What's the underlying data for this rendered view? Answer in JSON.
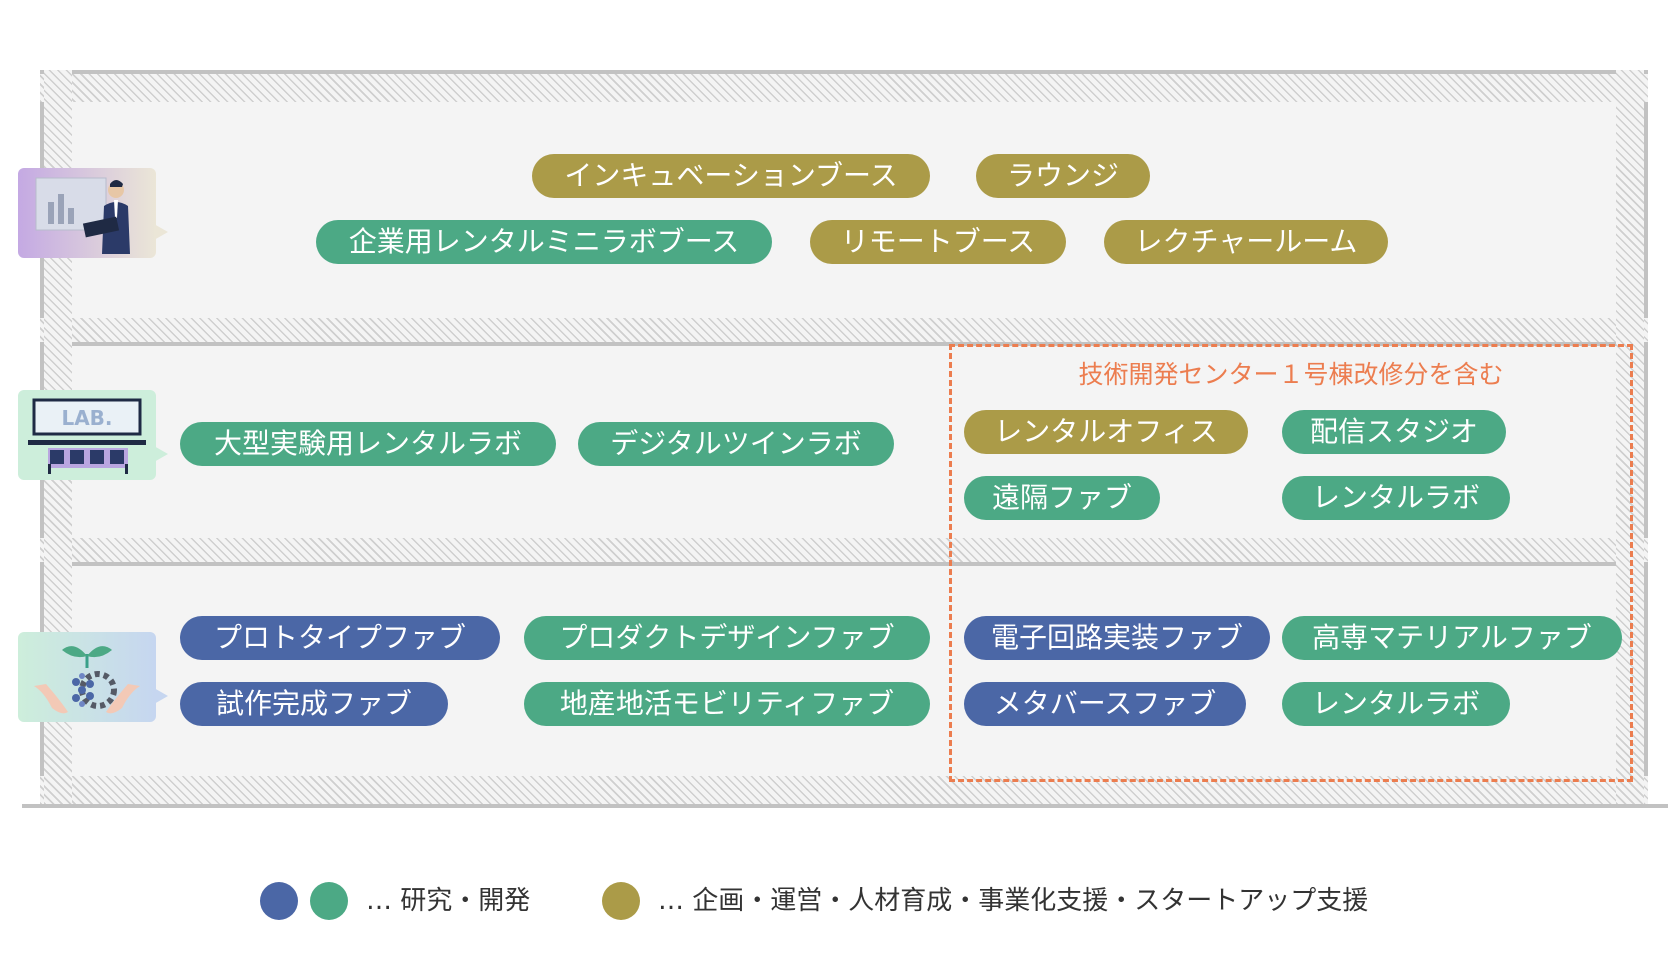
{
  "colors": {
    "research_blue": "#4b67a6",
    "research_green": "#4ca985",
    "planning_gold": "#ab9b48",
    "highlight_orange": "#ec7d4f",
    "wall_gray": "#c2c2c2"
  },
  "floors": {
    "top": {
      "icon": "presenter-icon",
      "pills": [
        {
          "label": "インキュベーションブース",
          "color": "gold"
        },
        {
          "label": "ラウンジ",
          "color": "gold"
        },
        {
          "label": "企業用レンタルミニラボブース",
          "color": "green"
        },
        {
          "label": "リモートブース",
          "color": "gold"
        },
        {
          "label": "レクチャールーム",
          "color": "gold"
        }
      ]
    },
    "middle": {
      "icon": "lab-icon",
      "pills": [
        {
          "label": "大型実験用レンタルラボ",
          "color": "green"
        },
        {
          "label": "デジタルツインラボ",
          "color": "green"
        },
        {
          "label": "レンタルオフィス",
          "color": "gold"
        },
        {
          "label": "配信スタジオ",
          "color": "green"
        },
        {
          "label": "遠隔ファブ",
          "color": "green"
        },
        {
          "label": "レンタルラボ",
          "color": "green"
        }
      ]
    },
    "bottom": {
      "icon": "innovation-icon",
      "pills": [
        {
          "label": "プロトタイプファブ",
          "color": "blue"
        },
        {
          "label": "プロダクトデザインファブ",
          "color": "green"
        },
        {
          "label": "試作完成ファブ",
          "color": "blue"
        },
        {
          "label": "地産地活モビリティファブ",
          "color": "green"
        },
        {
          "label": "電子回路実装ファブ",
          "color": "blue"
        },
        {
          "label": "高専マテリアルファブ",
          "color": "green"
        },
        {
          "label": "メタバースファブ",
          "color": "blue"
        },
        {
          "label": "レンタルラボ",
          "color": "green"
        }
      ]
    }
  },
  "highlight_area": {
    "label": "技術開発センター１号棟改修分を含む"
  },
  "legend": {
    "research": "…  研究・開発",
    "planning": "…  企画・運営・人材育成・事業化支援・スタートアップ支援"
  }
}
